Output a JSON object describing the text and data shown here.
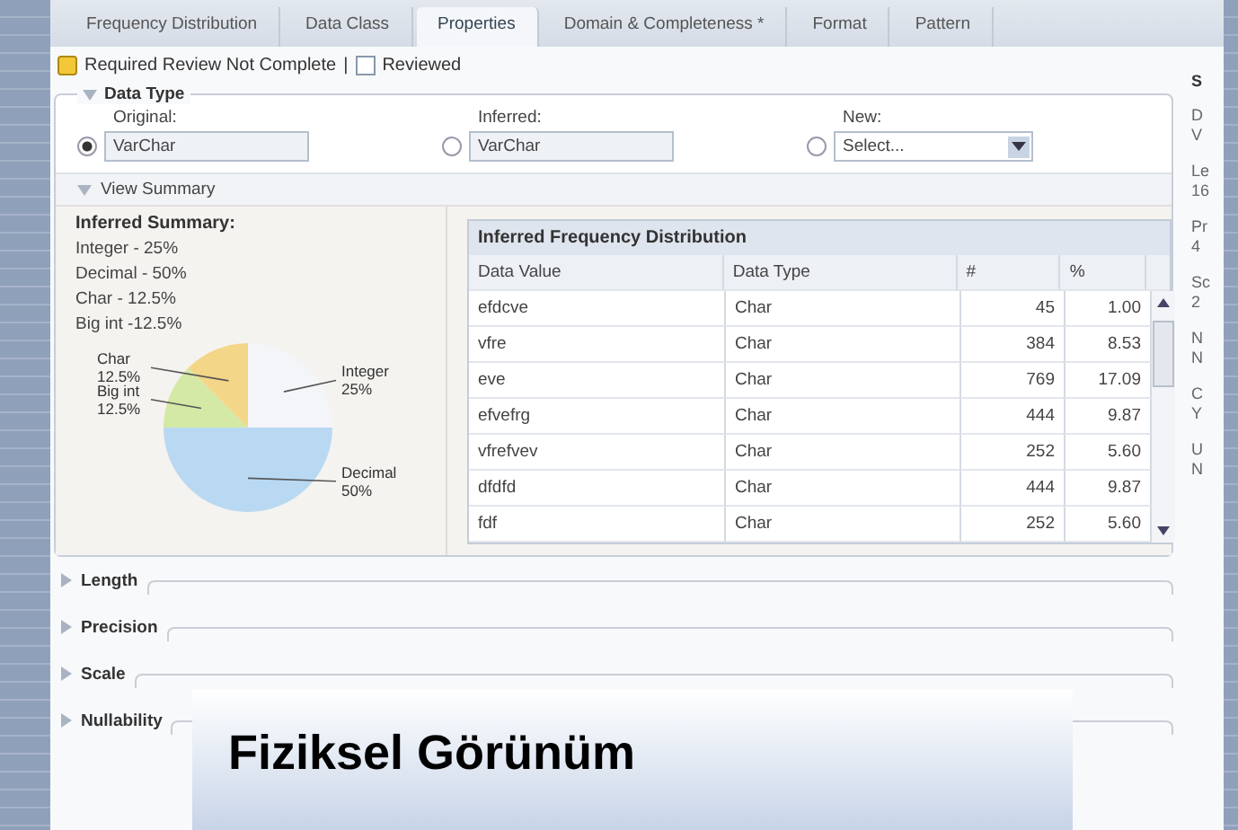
{
  "tabs": [
    {
      "label": "Frequency Distribution",
      "selected": false
    },
    {
      "label": "Data Class",
      "selected": false
    },
    {
      "label": "Properties",
      "selected": true
    },
    {
      "label": "Domain & Completeness *",
      "selected": false
    },
    {
      "label": "Format",
      "selected": false
    },
    {
      "label": "Pattern",
      "selected": false
    }
  ],
  "review": {
    "warning": "Required Review Not Complete",
    "separator": "|",
    "reviewed": {
      "label": "Reviewed",
      "checked": false
    }
  },
  "data_type": {
    "title": "Data Type",
    "expanded": true,
    "options": [
      {
        "kind": "text",
        "label": "Original:",
        "value": "VarChar",
        "selected": true
      },
      {
        "kind": "text",
        "label": "Inferred:",
        "value": "VarChar",
        "selected": false
      },
      {
        "kind": "select",
        "label": "New:",
        "value": "Select...",
        "selected": false
      }
    ]
  },
  "view_summary": {
    "title": "View Summary",
    "expanded": true
  },
  "summary": {
    "title": "Inferred Summary:",
    "lines": [
      "Integer - 25%",
      "Decimal - 50%",
      "Char - 12.5%",
      "Big int -12.5%"
    ],
    "chart_data": {
      "type": "pie",
      "categories": [
        "Integer",
        "Decimal",
        "Big int",
        "Char"
      ],
      "values": [
        25,
        50,
        12.5,
        12.5
      ],
      "value_labels": [
        "25%",
        "50%",
        "12.5%",
        "12.5%"
      ]
    }
  },
  "table": {
    "title": "Inferred Frequency Distribution",
    "columns": [
      "Data Value",
      "Data Type",
      "#",
      "%"
    ],
    "rows": [
      [
        "efdcve",
        "Char",
        "45",
        "1.00"
      ],
      [
        "vfre",
        "Char",
        "384",
        "8.53"
      ],
      [
        "eve",
        "Char",
        "769",
        "17.09"
      ],
      [
        "efvefrg",
        "Char",
        "444",
        "9.87"
      ],
      [
        "vfrefvev",
        "Char",
        "252",
        "5.60"
      ],
      [
        "dfdfd",
        "Char",
        "444",
        "9.87"
      ],
      [
        "fdf",
        "Char",
        "252",
        "5.60"
      ]
    ]
  },
  "sections": [
    {
      "label": "Length",
      "expanded": false
    },
    {
      "label": "Precision",
      "expanded": false
    },
    {
      "label": "Scale",
      "expanded": false
    },
    {
      "label": "Nullability",
      "expanded": false
    }
  ],
  "sidebar": {
    "title": "S",
    "lines": [
      "D",
      "V",
      "Le",
      "16",
      "Pr",
      "4",
      "Sc",
      "2",
      "N",
      "N",
      "C",
      "Y",
      "U",
      "N"
    ]
  },
  "caption": "Fiziksel Görünüm"
}
